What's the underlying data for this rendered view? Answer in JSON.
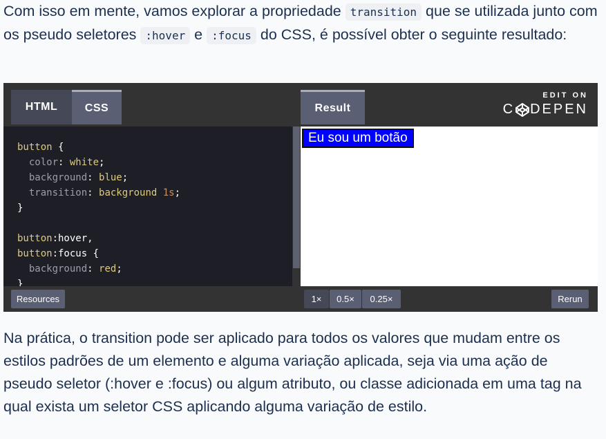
{
  "intro": {
    "t1": "Com isso em mente, vamos explorar a propriedade ",
    "code1": "transition",
    "t2": " que se utilizada junto com os pseudo seletores ",
    "code2": ":hover",
    "t3": " e ",
    "code3": ":focus",
    "t4": " do CSS, é possível obter o seguinte resultado:"
  },
  "codepen": {
    "tabs": [
      "HTML",
      "CSS"
    ],
    "result_tab": "Result",
    "edit_on": "EDIT ON",
    "brand_c": "C",
    "brand_rest": "DEPEN",
    "demo_button": "Eu sou um botão",
    "bottom": {
      "resources": "Resources",
      "zoom": [
        "1×",
        "0.5×",
        "0.25×"
      ],
      "rerun": "Rerun"
    },
    "code_lines": {
      "l1_sel": "button",
      "l1_brace": " {",
      "l2_prop": "color",
      "l2_val": "white",
      "l3_prop": "background",
      "l3_val": "blue",
      "l4_prop": "transition",
      "l4_val": "background",
      "l4_num": "1s",
      "l5": "}",
      "l7_sel": "button",
      "l7_pseudo": ":hover",
      "l8_sel": "button",
      "l8_pseudo": ":focus",
      "l9_prop": "background",
      "l9_val": "red",
      "l10": "}"
    }
  },
  "outro": "Na prática, o transition pode ser aplicado para todos os valores que mudam entre os estilos padrões de um elemento e alguma variação aplicada, seja via uma ação de pseudo seletor (:hover e :focus) ou algum atributo, ou classe adicionada em uma tag na qual exista um seletor CSS aplicando alguma variação de estilo."
}
